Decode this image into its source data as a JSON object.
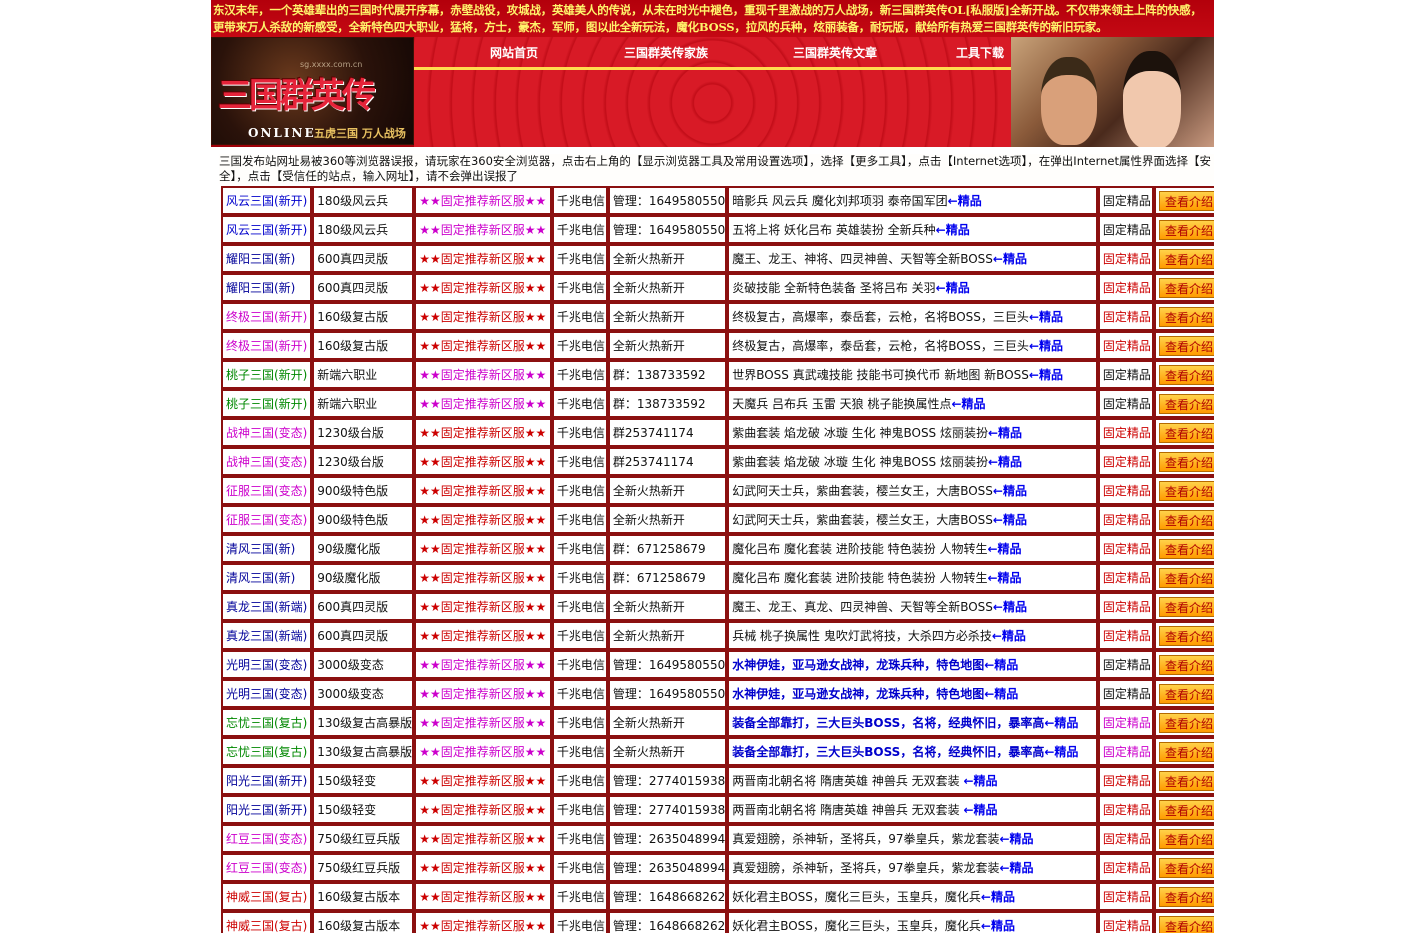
{
  "banner": {
    "intro": "东汉末年，一个英雄辈出的三国时代展开序幕，赤壁战役，攻城战，英雄美人的传说，从未在时光中褪色，重现千里激战的万人战场，新三国群英传OL[私服版]全新开战。不仅带来领主上阵的快感，更带来万人杀敌的新感受，全新特色四大职业，猛将，方士，豪杰，军师，图以此全新玩法，魔化BOSS，拉风的兵种，炫丽装备，耐玩版，献给所有热爱三国群英传的新旧玩家。",
    "logo_title": "三国群英传",
    "logo_sub": "ONLINE",
    "logo_tag": "五虎三国 万人战场",
    "logo_url": "sg.xxxx.com.cn",
    "nav": [
      "网站首页",
      "三国群英传家族",
      "三国群英传文章",
      "工具下载"
    ]
  },
  "notice": "三国发布站网址易被360等浏览器误报，请玩家在360安全浏览器，点击右上角的【显示浏览器工具及常用设置选项】，选择【更多工具】，点击【Internet选项】，在弹出Internet属性界面选择【安全】，点击【受信任的站点，输入网址】，请不会弹出误报了",
  "feat_suffix": "←精品",
  "button_label": "查看介绍",
  "rows": [
    {
      "name": "风云三国(新开)",
      "name_color": "#0000cc",
      "ver": "180级风云兵",
      "rec": "★★固定推荐新区服★★",
      "rec_color": "#cc00cc",
      "line": "千兆电信",
      "info": "管理：1649580550",
      "feat": "暗影兵 风云兵 魔化刘邦项羽 泰帝国军团",
      "feat_color": "#111111",
      "type": "固定精品",
      "type_color": "#111111"
    },
    {
      "name": "风云三国(新开)",
      "name_color": "#0000cc",
      "ver": "180级风云兵",
      "rec": "★★固定推荐新区服★★",
      "rec_color": "#cc00cc",
      "line": "千兆电信",
      "info": "管理：1649580550",
      "feat": "五将上将 妖化吕布 英雄装扮 全新兵种",
      "feat_color": "#111111",
      "type": "固定精品",
      "type_color": "#111111"
    },
    {
      "name": "耀阳三国(新)",
      "name_color": "#000099",
      "ver": "600真四灵版",
      "rec": "★★固定推荐新区服★★",
      "rec_color": "#cc0000",
      "line": "千兆电信",
      "info": "全新火热新开",
      "feat": "魔王、龙王、神将、四灵神兽、天智等全新BOSS",
      "feat_color": "#111111",
      "type": "固定精品",
      "type_color": "#cc0000"
    },
    {
      "name": "耀阳三国(新)",
      "name_color": "#000099",
      "ver": "600真四灵版",
      "rec": "★★固定推荐新区服★★",
      "rec_color": "#cc0000",
      "line": "千兆电信",
      "info": "全新火热新开",
      "feat": "炎破技能 全新特色装备 圣将吕布 关羽",
      "feat_color": "#111111",
      "type": "固定精品",
      "type_color": "#cc0000"
    },
    {
      "name": "终极三国(新开)",
      "name_color": "#cc00cc",
      "ver": "160级复古版",
      "rec": "★★固定推荐新区服★★",
      "rec_color": "#cc0000",
      "line": "千兆电信",
      "info": "全新火热新开",
      "feat": "终极复古，高爆率，泰岳套，云枪，名将BOSS，三巨头",
      "feat_color": "#111111",
      "type": "固定精品",
      "type_color": "#cc0000"
    },
    {
      "name": "终极三国(新开)",
      "name_color": "#cc00cc",
      "ver": "160级复古版",
      "rec": "★★固定推荐新区服★★",
      "rec_color": "#cc0000",
      "line": "千兆电信",
      "info": "全新火热新开",
      "feat": "终极复古，高爆率，泰岳套，云枪，名将BOSS，三巨头",
      "feat_color": "#111111",
      "type": "固定精品",
      "type_color": "#cc0000"
    },
    {
      "name": "桃子三国(新开)",
      "name_color": "#008800",
      "ver": "新端六职业",
      "rec": "★★固定推荐新区服★★",
      "rec_color": "#cc00cc",
      "line": "千兆电信",
      "info": "群：138733592",
      "feat": "世界BOSS 真武魂技能 技能书可换代币 新地图 新BOSS",
      "feat_color": "#111111",
      "type": "固定精品",
      "type_color": "#111111"
    },
    {
      "name": "桃子三国(新开)",
      "name_color": "#008800",
      "ver": "新端六职业",
      "rec": "★★固定推荐新区服★★",
      "rec_color": "#cc00cc",
      "line": "千兆电信",
      "info": "群：138733592",
      "feat": "天魔兵 吕布兵 玉雷 天狼 桃子能换属性点",
      "feat_color": "#111111",
      "type": "固定精品",
      "type_color": "#111111"
    },
    {
      "name": "战神三国(变态)",
      "name_color": "#cc00cc",
      "ver": "1230级台版",
      "rec": "★★固定推荐新区服★★",
      "rec_color": "#cc0000",
      "line": "千兆电信",
      "info": "群253741174",
      "feat": "紫曲套装 焰龙破 冰璇 生化 神鬼BOSS 炫丽装扮",
      "feat_color": "#111111",
      "type": "固定精品",
      "type_color": "#cc0000"
    },
    {
      "name": "战神三国(变态)",
      "name_color": "#cc00cc",
      "ver": "1230级台版",
      "rec": "★★固定推荐新区服★★",
      "rec_color": "#cc0000",
      "line": "千兆电信",
      "info": "群253741174",
      "feat": "紫曲套装 焰龙破 冰璇 生化 神鬼BOSS 炫丽装扮",
      "feat_color": "#111111",
      "type": "固定精品",
      "type_color": "#cc0000"
    },
    {
      "name": "征服三国(变态)",
      "name_color": "#cc00cc",
      "ver": "900级特色版",
      "rec": "★★固定推荐新区服★★",
      "rec_color": "#cc0000",
      "line": "千兆电信",
      "info": "全新火热新开",
      "feat": "幻武阿天士兵，紫曲套装，樱兰女王，大唐BOSS",
      "feat_color": "#111111",
      "type": "固定精品",
      "type_color": "#cc0000"
    },
    {
      "name": "征服三国(变态)",
      "name_color": "#cc00cc",
      "ver": "900级特色版",
      "rec": "★★固定推荐新区服★★",
      "rec_color": "#cc0000",
      "line": "千兆电信",
      "info": "全新火热新开",
      "feat": "幻武阿天士兵，紫曲套装，樱兰女王，大唐BOSS",
      "feat_color": "#111111",
      "type": "固定精品",
      "type_color": "#cc0000"
    },
    {
      "name": "清风三国(新)",
      "name_color": "#000099",
      "ver": "90级魔化版",
      "rec": "★★固定推荐新区服★★",
      "rec_color": "#cc0000",
      "line": "千兆电信",
      "info": "群：671258679",
      "feat": "魔化吕布  魔化套装  进阶技能  特色装扮  人物转生",
      "feat_color": "#111111",
      "type": "固定精品",
      "type_color": "#cc0000"
    },
    {
      "name": "清风三国(新)",
      "name_color": "#000099",
      "ver": "90级魔化版",
      "rec": "★★固定推荐新区服★★",
      "rec_color": "#cc0000",
      "line": "千兆电信",
      "info": "群：671258679",
      "feat": "魔化吕布  魔化套装  进阶技能  特色装扮  人物转生",
      "feat_color": "#111111",
      "type": "固定精品",
      "type_color": "#cc0000"
    },
    {
      "name": "真龙三国(新端)",
      "name_color": "#000099",
      "ver": "600真四灵版",
      "rec": "★★固定推荐新区服★★",
      "rec_color": "#cc0000",
      "line": "千兆电信",
      "info": "全新火热新开",
      "feat": "魔王、龙王、真龙、四灵神兽、天智等全新BOSS",
      "feat_color": "#111111",
      "type": "固定精品",
      "type_color": "#cc0000"
    },
    {
      "name": "真龙三国(新端)",
      "name_color": "#000099",
      "ver": "600真四灵版",
      "rec": "★★固定推荐新区服★★",
      "rec_color": "#cc0000",
      "line": "千兆电信",
      "info": "全新火热新开",
      "feat": "兵械 桃子换属性 鬼吹灯武将技，大杀四方必杀技",
      "feat_color": "#111111",
      "type": "固定精品",
      "type_color": "#cc0000"
    },
    {
      "name": "光明三国(变态)",
      "name_color": "#000099",
      "ver": "3000级变态",
      "rec": "★★固定推荐新区服★★",
      "rec_color": "#cc00cc",
      "line": "千兆电信",
      "info": "管理：1649580550",
      "feat": "水神伊娃，亚马逊女战神，龙珠兵种，特色地图",
      "feat_color": "#0000cc",
      "type": "固定精品",
      "type_color": "#111111"
    },
    {
      "name": "光明三国(变态)",
      "name_color": "#000099",
      "ver": "3000级变态",
      "rec": "★★固定推荐新区服★★",
      "rec_color": "#cc00cc",
      "line": "千兆电信",
      "info": "管理：1649580550",
      "feat": "水神伊娃，亚马逊女战神，龙珠兵种，特色地图",
      "feat_color": "#0000cc",
      "type": "固定精品",
      "type_color": "#111111"
    },
    {
      "name": "忘忧三国(复古)",
      "name_color": "#008800",
      "ver": "130级复古高暴版",
      "rec": "★★固定推荐新区服★★",
      "rec_color": "#cc00cc",
      "line": "千兆电信",
      "info": "全新火热新开",
      "feat": "装备全部靠打，三大巨头BOSS，名将，经典怀旧，暴率高",
      "feat_color": "#0000cc",
      "type": "固定精品",
      "type_color": "#cc00cc"
    },
    {
      "name": "忘忧三国(复古)",
      "name_color": "#008800",
      "ver": "130级复古高暴版",
      "rec": "★★固定推荐新区服★★",
      "rec_color": "#cc00cc",
      "line": "千兆电信",
      "info": "全新火热新开",
      "feat": "装备全部靠打，三大巨头BOSS，名将，经典怀旧，暴率高",
      "feat_color": "#0000cc",
      "type": "固定精品",
      "type_color": "#cc00cc"
    },
    {
      "name": "阳光三国(新开)",
      "name_color": "#000099",
      "ver": "150级轻变",
      "rec": "★★固定推荐新区服★★",
      "rec_color": "#cc0000",
      "line": "千兆电信",
      "info": "管理：2774015938",
      "feat": "两晋南北朝名将 隋唐英雄 神兽兵 无双套装 ",
      "feat_color": "#111111",
      "type": "固定精品",
      "type_color": "#cc0000"
    },
    {
      "name": "阳光三国(新开)",
      "name_color": "#000099",
      "ver": "150级轻变",
      "rec": "★★固定推荐新区服★★",
      "rec_color": "#cc0000",
      "line": "千兆电信",
      "info": "管理：2774015938",
      "feat": "两晋南北朝名将 隋唐英雄 神兽兵 无双套装 ",
      "feat_color": "#111111",
      "type": "固定精品",
      "type_color": "#cc0000"
    },
    {
      "name": "红豆三国(变态)",
      "name_color": "#cc00cc",
      "ver": "750级红豆兵版",
      "rec": "★★固定推荐新区服★★",
      "rec_color": "#cc0000",
      "line": "千兆电信",
      "info": "管理：2635048994",
      "feat": "真爱翅膀，杀神斩，圣将兵，97拳皇兵，紫龙套装",
      "feat_color": "#111111",
      "type": "固定精品",
      "type_color": "#cc0000"
    },
    {
      "name": "红豆三国(变态)",
      "name_color": "#cc00cc",
      "ver": "750级红豆兵版",
      "rec": "★★固定推荐新区服★★",
      "rec_color": "#cc0000",
      "line": "千兆电信",
      "info": "管理：2635048994",
      "feat": "真爱翅膀，杀神斩，圣将兵，97拳皇兵，紫龙套装",
      "feat_color": "#111111",
      "type": "固定精品",
      "type_color": "#cc0000"
    },
    {
      "name": "神威三国(复古)",
      "name_color": "#cc0000",
      "ver": "160级复古版本",
      "rec": "★★固定推荐新区服★★",
      "rec_color": "#cc0000",
      "line": "千兆电信",
      "info": "管理：1648668262",
      "feat": "妖化君主BOSS，魔化三巨头，玉皇兵，魔化兵",
      "feat_color": "#111111",
      "type": "固定精品",
      "type_color": "#cc0000"
    },
    {
      "name": "神威三国(复古)",
      "name_color": "#cc0000",
      "ver": "160级复古版本",
      "rec": "★★固定推荐新区服★★",
      "rec_color": "#cc0000",
      "line": "千兆电信",
      "info": "管理：1648668262",
      "feat": "妖化君主BOSS，魔化三巨头，玉皇兵，魔化兵",
      "feat_color": "#111111",
      "type": "固定精品",
      "type_color": "#cc0000"
    }
  ]
}
